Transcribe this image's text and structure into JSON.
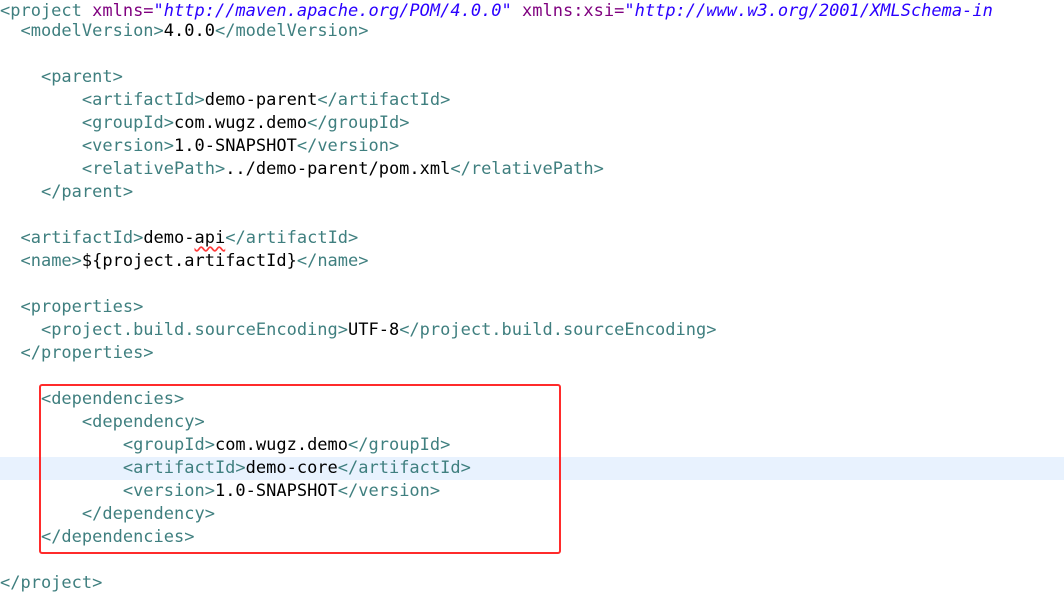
{
  "lines": {
    "l01": {
      "open": "<project",
      "a1": " xmlns=",
      "v1": "\"http://maven.apache.org/POM/4.0.0\"",
      "a2": " xmlns:xsi=",
      "v2": "\"http://www.w3.org/2001/XMLSchema-in"
    },
    "l02": {
      "indent": "  ",
      "open": "<modelVersion>",
      "text": "4.0.0",
      "close": "</modelVersion>"
    },
    "l04": {
      "indent": "    ",
      "open": "<parent>"
    },
    "l05": {
      "indent": "        ",
      "open": "<artifactId>",
      "text": "demo-parent",
      "close": "</artifactId>"
    },
    "l06": {
      "indent": "        ",
      "open": "<groupId>",
      "text": "com.wugz.demo",
      "close": "</groupId>"
    },
    "l07": {
      "indent": "        ",
      "open": "<version>",
      "text": "1.0-SNAPSHOT",
      "close": "</version>"
    },
    "l08": {
      "indent": "        ",
      "open": "<relativePath>",
      "text": "../demo-parent/pom.xml",
      "close": "</relativePath>"
    },
    "l09": {
      "indent": "    ",
      "close": "</parent>"
    },
    "l11": {
      "indent": "  ",
      "open": "<artifactId>",
      "text_a": "demo-",
      "text_b": "api",
      "close": "</artifactId>"
    },
    "l12": {
      "indent": "  ",
      "open": "<name>",
      "text": "${project.artifactId}",
      "close": "</name>"
    },
    "l14": {
      "indent": "  ",
      "open": "<properties>"
    },
    "l15": {
      "indent": "    ",
      "open": "<project.build.sourceEncoding>",
      "text": "UTF-8",
      "close": "</project.build.sourceEncoding>"
    },
    "l16": {
      "indent": "  ",
      "close": "</properties>"
    },
    "l18": {
      "indent": "    ",
      "open": "<dependencies>"
    },
    "l19": {
      "indent": "        ",
      "open": "<dependency>"
    },
    "l20": {
      "indent": "            ",
      "open": "<groupId>",
      "text": "com.wugz.demo",
      "close": "</groupId>"
    },
    "l21": {
      "indent": "            ",
      "open": "<artifactId>",
      "text": "demo-core",
      "close": "</artifactId>"
    },
    "l22": {
      "indent": "            ",
      "open": "<version>",
      "text": "1.0-SNAPSHOT",
      "close": "</version>"
    },
    "l23": {
      "indent": "        ",
      "close": "</dependency>"
    },
    "l24": {
      "indent": "    ",
      "close": "</dependencies>"
    },
    "l26": {
      "close": "</project>"
    }
  },
  "colors": {
    "tag": "#3f7f7f",
    "attribute": "#7f007f",
    "attribute_value": "#2a00ff",
    "text": "#000000",
    "current_line": "#e8f2fe",
    "highlight_box": "#ff2b2b"
  }
}
